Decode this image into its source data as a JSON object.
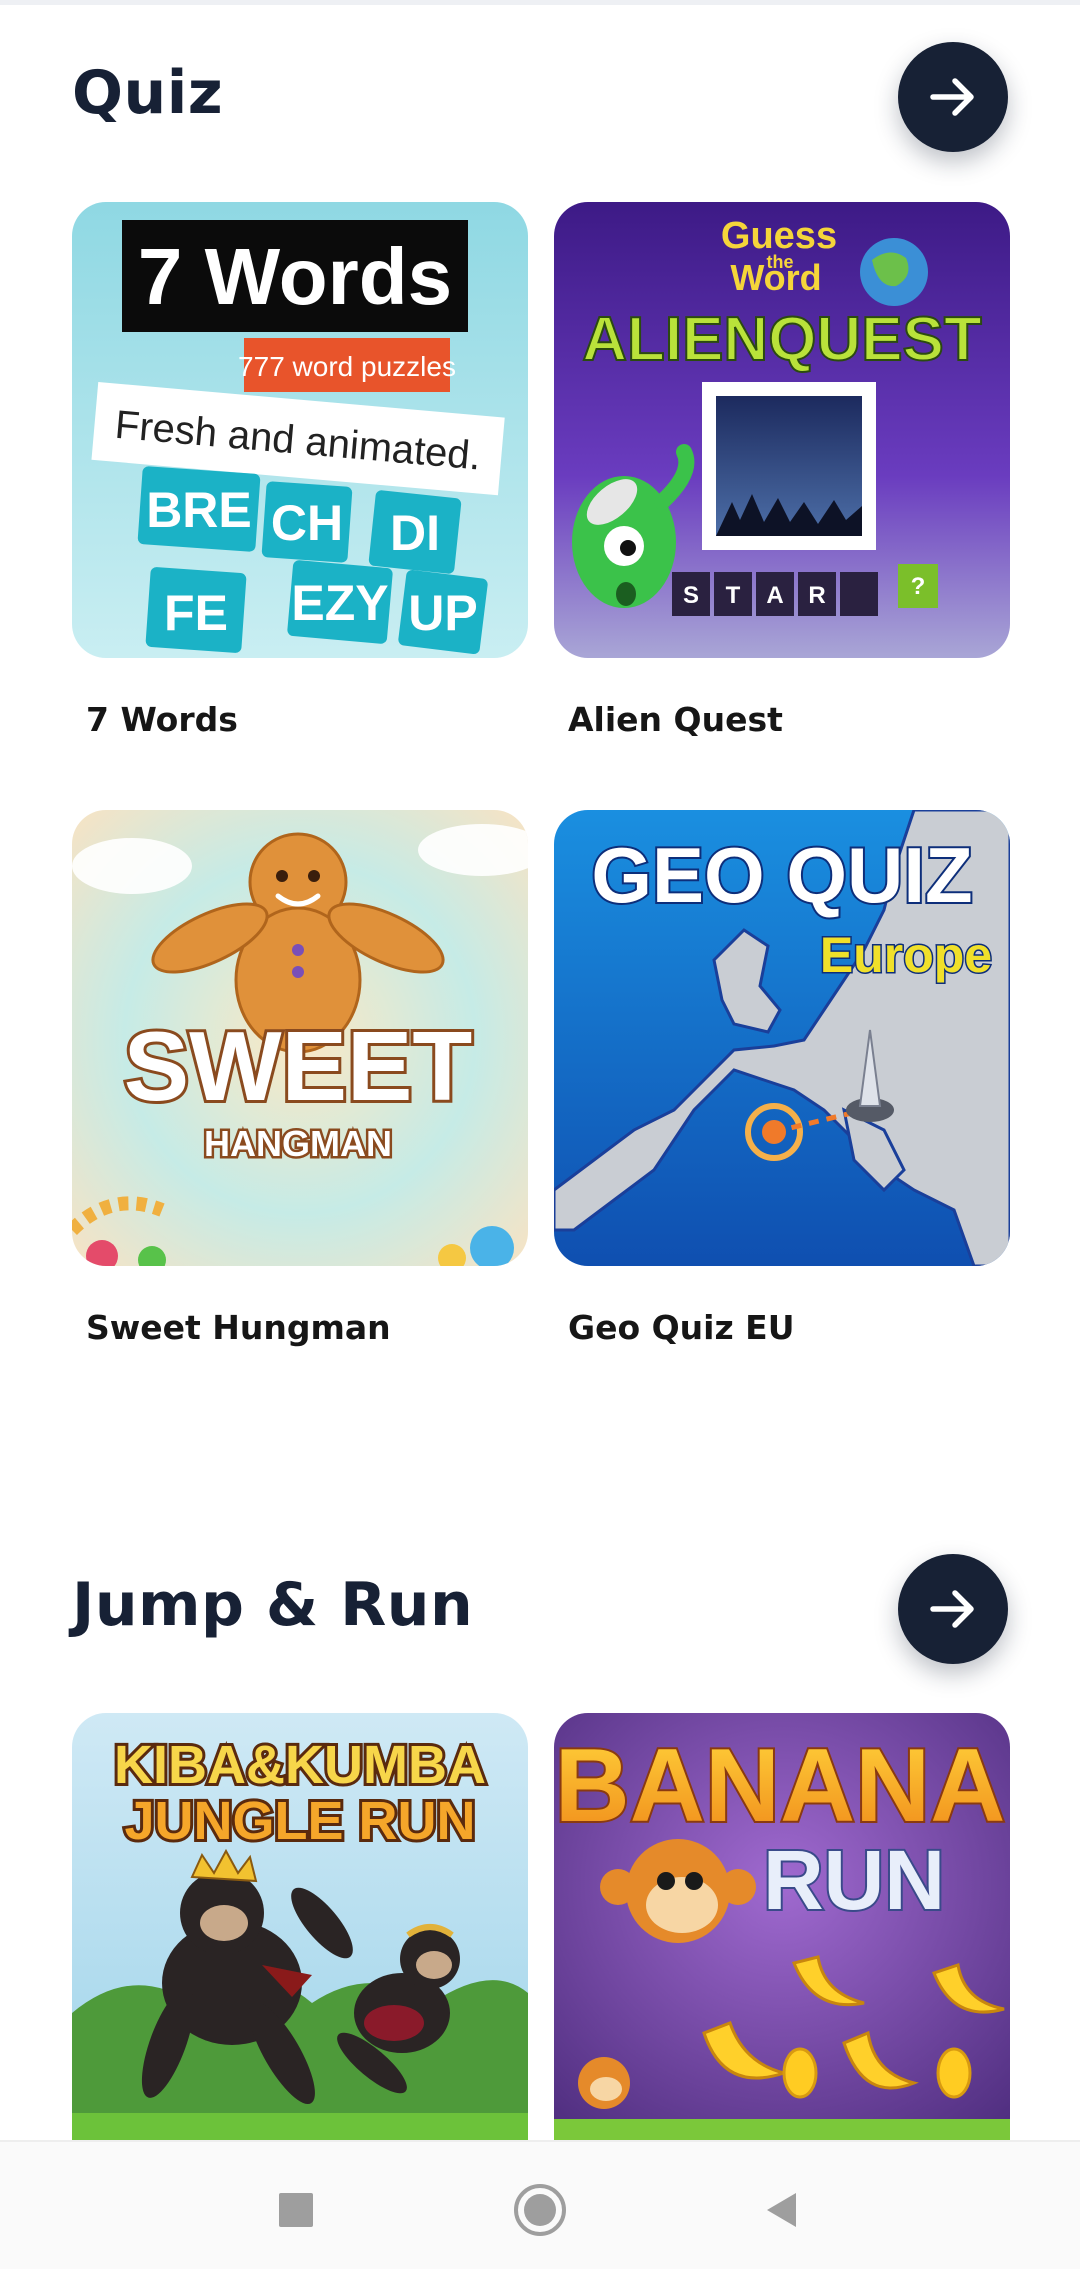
{
  "sections": [
    {
      "title": "Quiz",
      "more_icon": "arrow-right-icon",
      "games": [
        {
          "label": "7 Words",
          "thumb": {
            "banner": "7 Words",
            "tag": "777 word puzzles",
            "slogan": "Fresh and animated.",
            "tiles": [
              "BRE",
              "CH",
              "DI",
              "FE",
              "EZY",
              "UP"
            ]
          }
        },
        {
          "label": "Alien Quest",
          "thumb": {
            "line1": "Guess",
            "line2": "the",
            "line3": "Word",
            "logo": "ALIENQUEST",
            "letters": [
              "S",
              "T",
              "A",
              "R",
              "",
              "?"
            ]
          }
        },
        {
          "label": "Sweet Hungman",
          "thumb": {
            "logo": "SWEET",
            "sub": "HANGMAN"
          }
        },
        {
          "label": "Geo Quiz EU",
          "thumb": {
            "logo": "GEO QUIZ",
            "sub": "Europe"
          }
        }
      ]
    },
    {
      "title": "Jump & Run",
      "more_icon": "arrow-right-icon",
      "games": [
        {
          "thumb": {
            "line1": "KIBA&KUMBA",
            "line2": "JUNGLE RUN"
          }
        },
        {
          "thumb": {
            "line1": "BANANA",
            "line2": "RUN"
          }
        }
      ]
    }
  ],
  "navbar": {
    "icons": [
      "recents-square-icon",
      "home-circle-icon",
      "back-triangle-icon"
    ]
  },
  "colors": {
    "primary": "#172135",
    "background": "#ffffff"
  }
}
